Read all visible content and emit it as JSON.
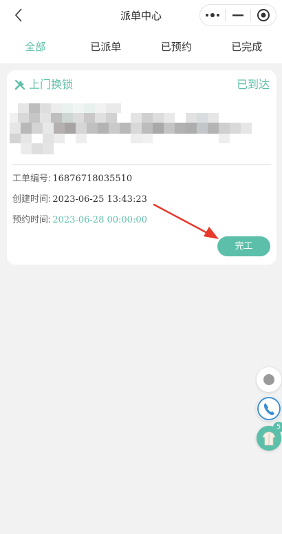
{
  "nav": {
    "title": "派单中心",
    "back_icon": "chevron-left-icon",
    "more_icon": "more-dots-icon",
    "minimize_icon": "minimize-icon",
    "close_icon": "target-close-icon"
  },
  "tabs": [
    {
      "label": "全部",
      "active": true
    },
    {
      "label": "已派单",
      "active": false
    },
    {
      "label": "已预约",
      "active": false
    },
    {
      "label": "已完成",
      "active": false
    }
  ],
  "order": {
    "service_type": "上门换锁",
    "status": "已到达",
    "order_no_label": "工单编号:",
    "order_no": "16876718035510",
    "created_label": "创建时间:",
    "created": "2023-06-25 13:43:23",
    "appointment_label": "预约时间:",
    "appointment": "2023-06-28 00:00:00",
    "finish_button": "完工"
  },
  "floating": {
    "badge_count": "5"
  },
  "colors": {
    "accent": "#5cbfa9",
    "arrow": "#e8392b"
  }
}
